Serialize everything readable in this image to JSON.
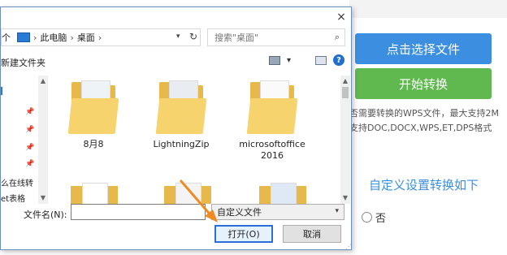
{
  "background": {
    "choose_file_button": "点击选择文件",
    "start_convert_button": "开始转换",
    "hint_line1": "否需要转换的WPS文件，最大支持2M",
    "hint_line2": "支持DOC,DOCX,WPS,ET,DPS格式",
    "custom_title": "自定义设置转换如下",
    "radio_no_label": "否",
    "colors": {
      "blue": "#3c8fe0",
      "green": "#5fb94f"
    }
  },
  "dialog": {
    "close_label": "×",
    "breadcrumb": [
      "个",
      "此电脑",
      "桌面"
    ],
    "refresh_icon": "↻",
    "search_placeholder": "搜索\"桌面\"",
    "new_folder": "新建文件夹",
    "nav_items": [
      "么在线转",
      "et表格"
    ],
    "files": [
      {
        "name": "8月8",
        "icon": "folder-icon"
      },
      {
        "name": "LightningZip",
        "icon": "folder-icon"
      },
      {
        "name": "microsoftoffice\n2016",
        "icon": "folder-icon"
      }
    ],
    "filename_label": "文件名(N):",
    "filename_value": "",
    "filter_value": "自定义文件",
    "open_button": "打开(O)",
    "cancel_button": "取消"
  }
}
